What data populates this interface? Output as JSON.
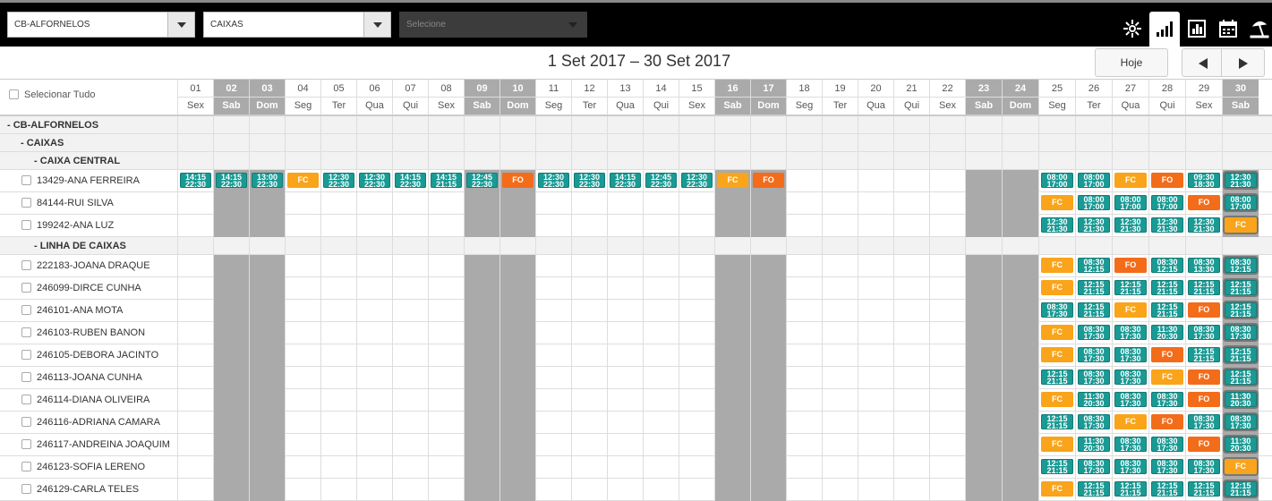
{
  "toolbar": {
    "store_select": "CB-ALFORNELOS",
    "department_select": "CAIXAS",
    "third_select": "Selecione",
    "icons": [
      "settings-icon",
      "bar-chart-icon",
      "report-chart-icon",
      "calendar-icon",
      "vacation-icon"
    ]
  },
  "nav": {
    "range": "1 Set 2017 – 30 Set 2017",
    "today_label": "Hoje",
    "prev_icon": "triangle-left-icon",
    "next_icon": "triangle-right-icon"
  },
  "select_all_label": "Selecionar Tudo",
  "days": [
    {
      "n": "01",
      "w": "Sex",
      "we": false
    },
    {
      "n": "02",
      "w": "Sab",
      "we": true
    },
    {
      "n": "03",
      "w": "Dom",
      "we": true
    },
    {
      "n": "04",
      "w": "Seg",
      "we": false
    },
    {
      "n": "05",
      "w": "Ter",
      "we": false
    },
    {
      "n": "06",
      "w": "Qua",
      "we": false
    },
    {
      "n": "07",
      "w": "Qui",
      "we": false
    },
    {
      "n": "08",
      "w": "Sex",
      "we": false
    },
    {
      "n": "09",
      "w": "Sab",
      "we": true
    },
    {
      "n": "10",
      "w": "Dom",
      "we": true
    },
    {
      "n": "11",
      "w": "Seg",
      "we": false
    },
    {
      "n": "12",
      "w": "Ter",
      "we": false
    },
    {
      "n": "13",
      "w": "Qua",
      "we": false
    },
    {
      "n": "14",
      "w": "Qui",
      "we": false
    },
    {
      "n": "15",
      "w": "Sex",
      "we": false
    },
    {
      "n": "16",
      "w": "Sab",
      "we": true
    },
    {
      "n": "17",
      "w": "Dom",
      "we": true
    },
    {
      "n": "18",
      "w": "Seg",
      "we": false
    },
    {
      "n": "19",
      "w": "Ter",
      "we": false
    },
    {
      "n": "20",
      "w": "Qua",
      "we": false
    },
    {
      "n": "21",
      "w": "Qui",
      "we": false
    },
    {
      "n": "22",
      "w": "Sex",
      "we": false
    },
    {
      "n": "23",
      "w": "Sab",
      "we": true
    },
    {
      "n": "24",
      "w": "Dom",
      "we": true
    },
    {
      "n": "25",
      "w": "Seg",
      "we": false
    },
    {
      "n": "26",
      "w": "Ter",
      "we": false
    },
    {
      "n": "27",
      "w": "Qua",
      "we": false
    },
    {
      "n": "28",
      "w": "Qui",
      "we": false
    },
    {
      "n": "29",
      "w": "Sex",
      "we": false
    },
    {
      "n": "30",
      "w": "Sab",
      "we": true
    }
  ],
  "rows": [
    {
      "type": "group",
      "level": 0,
      "label": "- CB-ALFORNELOS"
    },
    {
      "type": "group",
      "level": 1,
      "label": "- CAIXAS"
    },
    {
      "type": "group",
      "level": 2,
      "label": "- CAIXA CENTRAL"
    },
    {
      "type": "emp",
      "label": "13429-ANA FERREIRA",
      "shifts": {
        "01": "14:15|22:30",
        "02": "14:15|22:30",
        "03": "13:00|22:30",
        "04": "FC",
        "05": "12:30|22:30",
        "06": "12:30|22:30",
        "07": "14:15|22:30",
        "08": "14:15|21:15",
        "09": "12:45|22:30",
        "10": "FO",
        "11": "12:30|22:30",
        "12": "12:30|22:30",
        "13": "14:15|22:30",
        "14": "12:45|22:30",
        "15": "12:30|22:30",
        "16": "FC",
        "17": "FO",
        "25": "08:00|17:00",
        "26": "08:00|17:00",
        "27": "FC",
        "28": "FO",
        "29": "09:30|18:30",
        "30": "12:30|21:30"
      }
    },
    {
      "type": "emp",
      "label": "84144-RUI SILVA",
      "shifts": {
        "25": "FC",
        "26": "08:00|17:00",
        "27": "08:00|17:00",
        "28": "08:00|17:00",
        "29": "FO",
        "30": "08:00|17:00"
      }
    },
    {
      "type": "emp",
      "label": "199242-ANA LUZ",
      "shifts": {
        "25": "12:30|21:30",
        "26": "12:30|21:30",
        "27": "12:30|21:30",
        "28": "12:30|21:30",
        "29": "12:30|21:30",
        "30": "FC"
      }
    },
    {
      "type": "group",
      "level": 2,
      "label": "- LINHA DE CAIXAS"
    },
    {
      "type": "emp",
      "label": "222183-JOANA DRAQUE",
      "shifts": {
        "25": "FC",
        "26": "08:30|12:15",
        "27": "FO",
        "28": "08:30|12:15",
        "29": "08:30|13:30",
        "30": "08:30|12:15"
      }
    },
    {
      "type": "emp",
      "label": "246099-DIRCE CUNHA",
      "shifts": {
        "25": "FC",
        "26": "12:15|21:15",
        "27": "12:15|21:15",
        "28": "12:15|21:15",
        "29": "12:15|21:15",
        "30": "12:15|21:15"
      }
    },
    {
      "type": "emp",
      "label": "246101-ANA MOTA",
      "shifts": {
        "25": "08:30|17:30",
        "26": "12:15|21:15",
        "27": "FC",
        "28": "12:15|21:15",
        "29": "FO",
        "30": "12:15|21:15"
      }
    },
    {
      "type": "emp",
      "label": "246103-RUBEN BANON",
      "shifts": {
        "25": "FC",
        "26": "08:30|17:30",
        "27": "08:30|17:30",
        "28": "11:30|20:30",
        "29": "08:30|17:30",
        "30": "08:30|17:30"
      }
    },
    {
      "type": "emp",
      "label": "246105-DEBORA JACINTO",
      "shifts": {
        "25": "FC",
        "26": "08:30|17:30",
        "27": "08:30|17:30",
        "28": "FO",
        "29": "12:15|21:15",
        "30": "12:15|21:15"
      }
    },
    {
      "type": "emp",
      "label": "246113-JOANA CUNHA",
      "shifts": {
        "25": "12:15|21:15",
        "26": "08:30|17:30",
        "27": "08:30|17:30",
        "28": "FC",
        "29": "FO",
        "30": "12:15|21:15"
      }
    },
    {
      "type": "emp",
      "label": "246114-DIANA OLIVEIRA",
      "shifts": {
        "25": "FC",
        "26": "11:30|20:30",
        "27": "08:30|17:30",
        "28": "08:30|17:30",
        "29": "FO",
        "30": "11:30|20:30"
      }
    },
    {
      "type": "emp",
      "label": "246116-ADRIANA CAMARA",
      "shifts": {
        "25": "12:15|21:15",
        "26": "08:30|17:30",
        "27": "FC",
        "28": "FO",
        "29": "08:30|17:30",
        "30": "08:30|17:30"
      }
    },
    {
      "type": "emp",
      "label": "246117-ANDREINA JOAQUIM",
      "shifts": {
        "25": "FC",
        "26": "11:30|20:30",
        "27": "08:30|17:30",
        "28": "08:30|17:30",
        "29": "FO",
        "30": "11:30|20:30"
      }
    },
    {
      "type": "emp",
      "label": "246123-SOFIA LERENO",
      "shifts": {
        "25": "12:15|21:15",
        "26": "08:30|17:30",
        "27": "08:30|17:30",
        "28": "08:30|17:30",
        "29": "08:30|17:30",
        "30": "FC"
      }
    },
    {
      "type": "emp",
      "label": "246129-CARLA TELES",
      "shifts": {
        "25": "FC",
        "26": "12:15|21:15",
        "27": "12:15|21:15",
        "28": "12:15|21:15",
        "29": "12:15|21:15",
        "30": "12:15|21:15"
      }
    }
  ]
}
